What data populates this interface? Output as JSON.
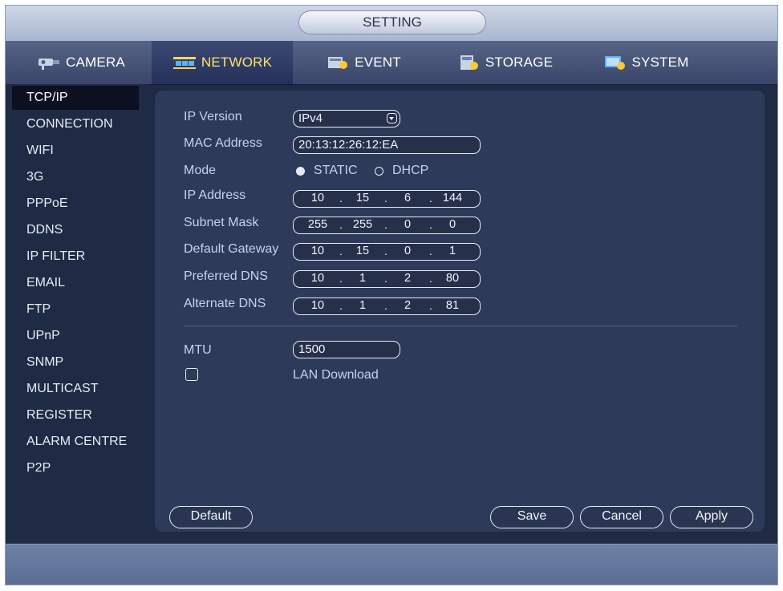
{
  "window": {
    "title": "SETTING"
  },
  "tabs": [
    {
      "label": "CAMERA",
      "icon": "camera-icon"
    },
    {
      "label": "NETWORK",
      "icon": "network-icon"
    },
    {
      "label": "EVENT",
      "icon": "event-icon"
    },
    {
      "label": "STORAGE",
      "icon": "storage-icon"
    },
    {
      "label": "SYSTEM",
      "icon": "system-icon"
    }
  ],
  "sidebar": {
    "items": [
      "TCP/IP",
      "CONNECTION",
      "WIFI",
      "3G",
      "PPPoE",
      "DDNS",
      "IP FILTER",
      "EMAIL",
      "FTP",
      "UPnP",
      "SNMP",
      "MULTICAST",
      "REGISTER",
      "ALARM CENTRE",
      "P2P"
    ],
    "selected": "TCP/IP"
  },
  "form": {
    "ip_version": {
      "label": "IP Version",
      "value": "IPv4"
    },
    "mac_address": {
      "label": "MAC Address",
      "value": "20:13:12:26:12:EA"
    },
    "mode": {
      "label": "Mode",
      "options": [
        "STATIC",
        "DHCP"
      ],
      "selected": "STATIC"
    },
    "ip_address": {
      "label": "IP Address",
      "octets": [
        "10",
        "15",
        "6",
        "144"
      ]
    },
    "subnet_mask": {
      "label": "Subnet Mask",
      "octets": [
        "255",
        "255",
        "0",
        "0"
      ]
    },
    "default_gateway": {
      "label": "Default Gateway",
      "octets": [
        "10",
        "15",
        "0",
        "1"
      ]
    },
    "preferred_dns": {
      "label": "Preferred DNS",
      "octets": [
        "10",
        "1",
        "2",
        "80"
      ]
    },
    "alternate_dns": {
      "label": "Alternate DNS",
      "octets": [
        "10",
        "1",
        "2",
        "81"
      ]
    },
    "mtu": {
      "label": "MTU",
      "value": "1500"
    },
    "lan_download": {
      "label": "LAN Download",
      "checked": false
    },
    "ip_separator": "."
  },
  "buttons": {
    "default": "Default",
    "save": "Save",
    "cancel": "Cancel",
    "apply": "Apply"
  },
  "colors": {
    "active_tab_text": "#ffe36a",
    "label_text": "#c4d2f0",
    "panel_bg": "#2e3a59"
  }
}
